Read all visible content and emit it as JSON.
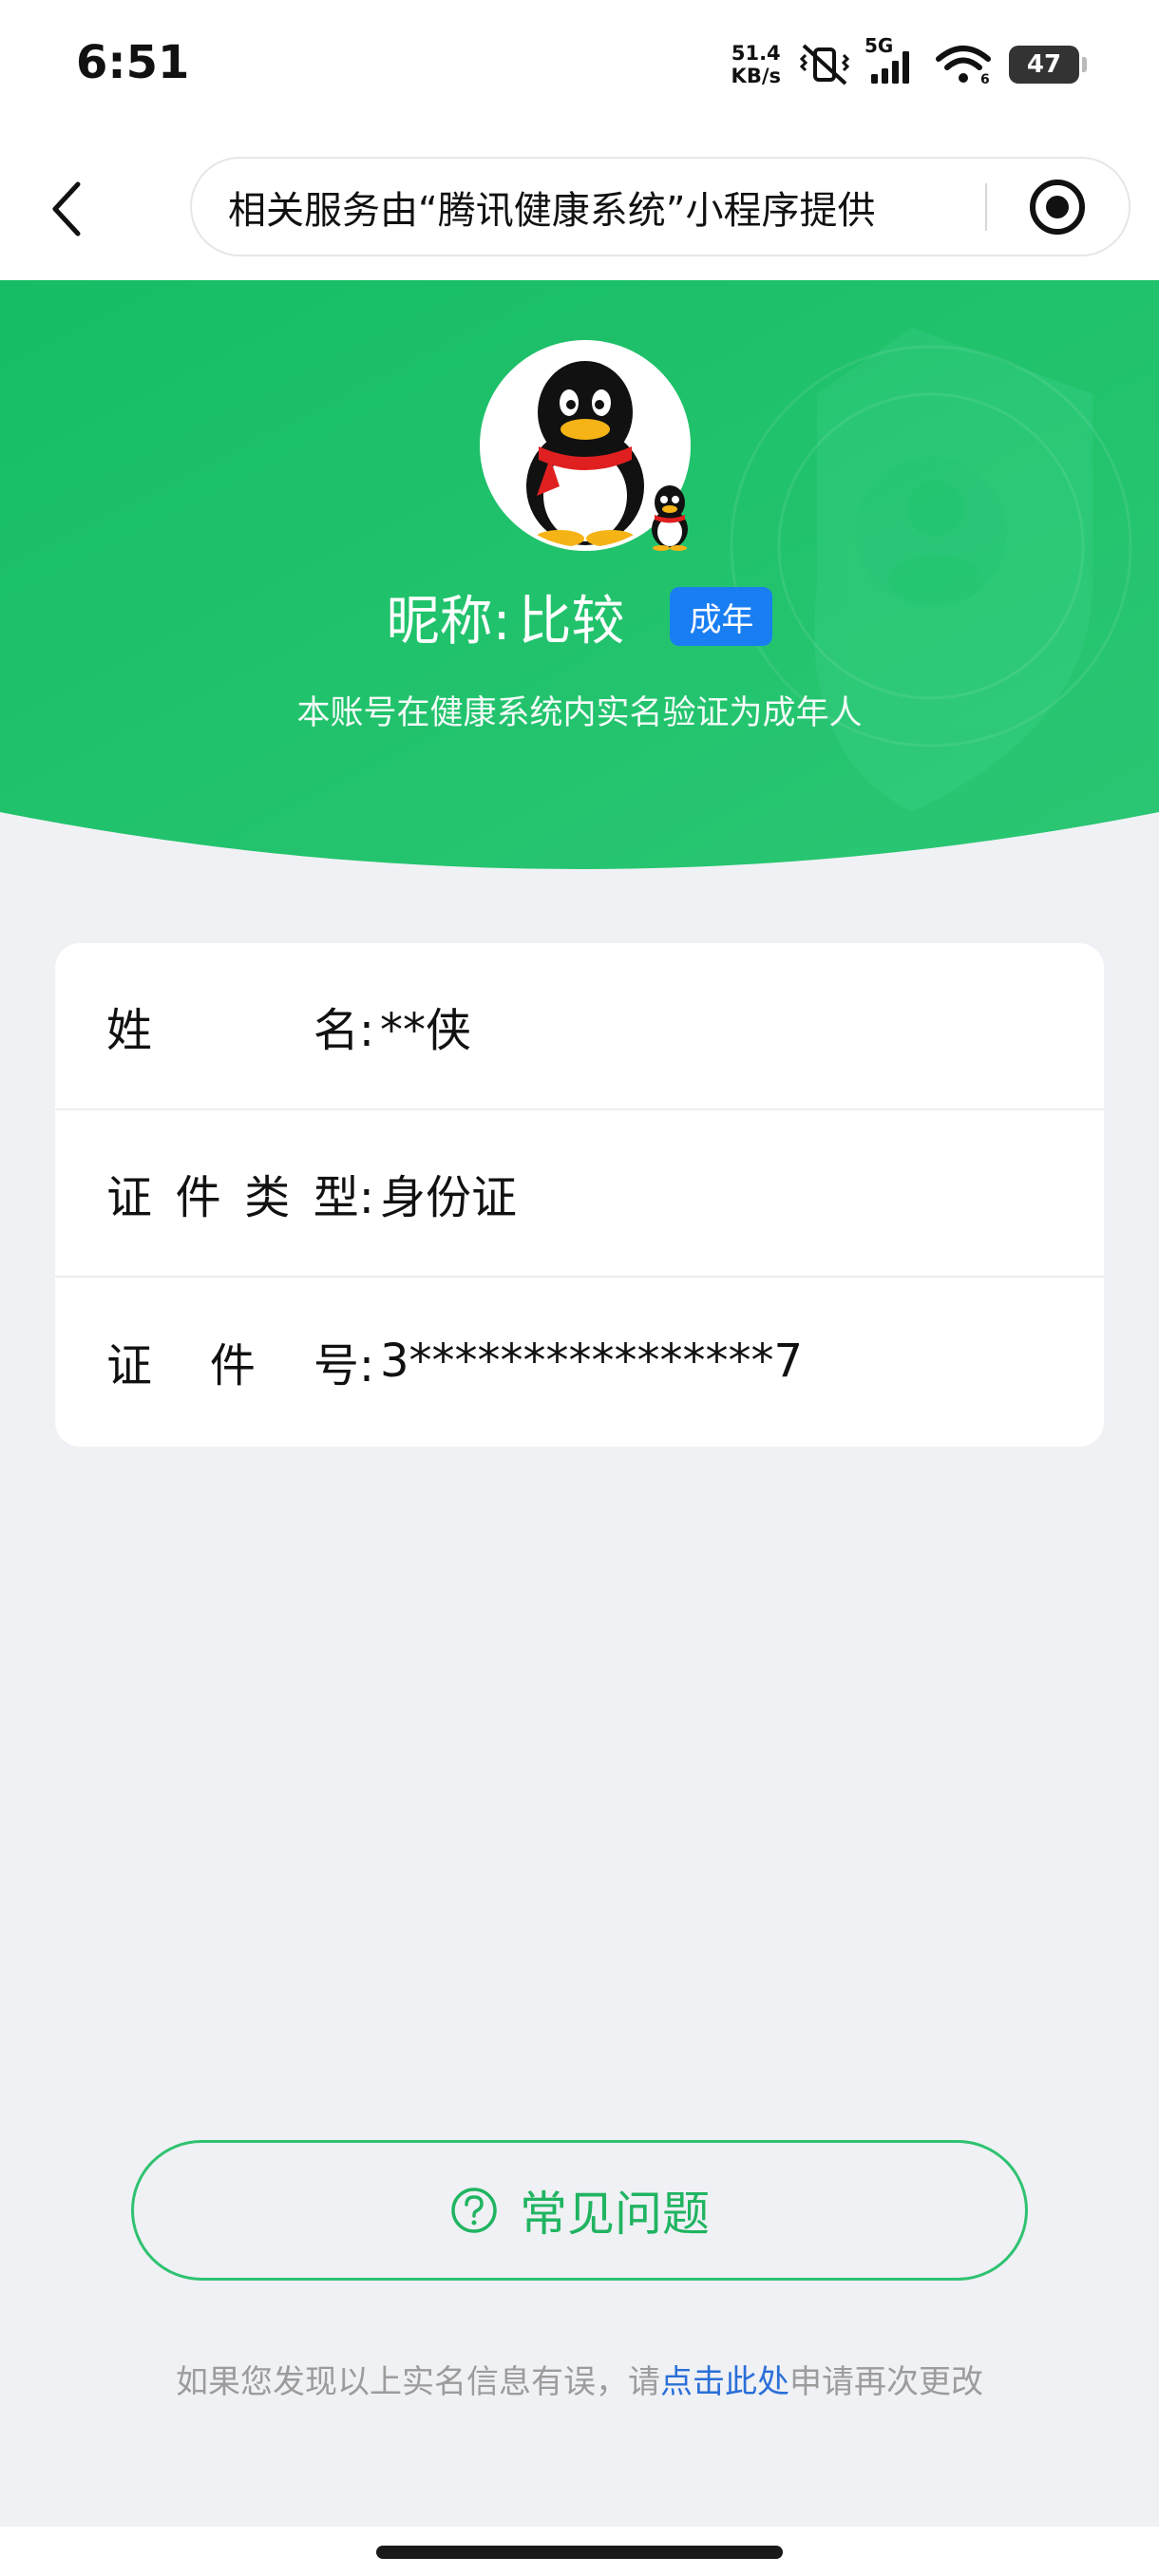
{
  "status_bar": {
    "time": "6:51",
    "net_speed_value": "51.4",
    "net_speed_unit": "KB/s",
    "network_type": "5G",
    "battery_level": "47",
    "icons": [
      "mute-vibrate-icon",
      "signal-icon",
      "wifi-icon",
      "battery-icon"
    ]
  },
  "nav": {
    "back_icon": "chevron-left-icon",
    "capsule_text": "相关服务由“腾讯健康系统”小程序提供",
    "target_icon": "target-icon"
  },
  "profile": {
    "nickname_label": "昵称:",
    "nickname_value": "比较",
    "badge": "成年",
    "verify_text": "本账号在健康系统内实名验证为成年人",
    "avatar_icon": "penguin-avatar-icon"
  },
  "info": {
    "rows": [
      {
        "label_chars": [
          "姓",
          "名:"
        ],
        "value": "**侠"
      },
      {
        "label_chars": [
          "证",
          "件",
          "类",
          "型:"
        ],
        "value": "身份证"
      },
      {
        "label_chars": [
          "证",
          "件",
          "号:"
        ],
        "value": "3****************7"
      }
    ]
  },
  "faq": {
    "label": "常见问题",
    "icon": "question-circle-icon"
  },
  "footer": {
    "before": "如果您发现以上实名信息有误，请",
    "link": "点击此处",
    "after": "申请再次更改"
  },
  "colors": {
    "header_green": "#22c06b",
    "accent_green": "#21b461",
    "badge_blue": "#1a7ef3",
    "link_blue": "#2a6fd8",
    "page_bg": "#eff1f5"
  }
}
